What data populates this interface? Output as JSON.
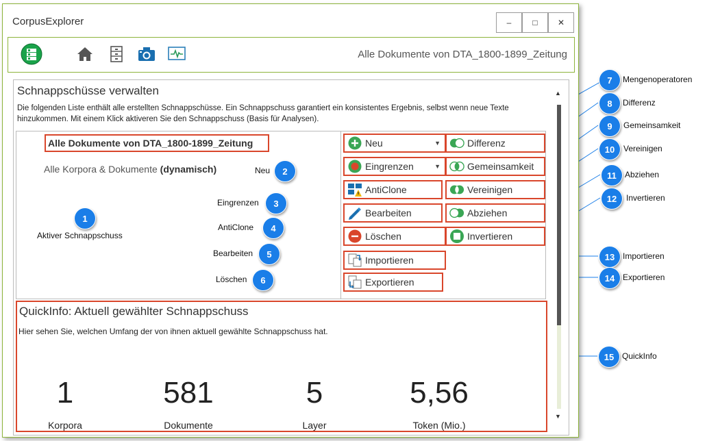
{
  "window": {
    "title": "CorpusExplorer",
    "minimize": "–",
    "maximize": "□",
    "close": "✕"
  },
  "toolbar": {
    "view_title": "Alle Dokumente von DTA_1800-1899_Zeitung"
  },
  "section": {
    "title": "Schnappschüsse verwalten",
    "description": "Die folgenden Liste enthält alle erstellten Schnappschüsse. Ein Schnappschuss garantiert ein konsistentes Ergebnis, selbst wenn neue Texte hinzukommen. Mit einem Klick aktiveren Sie den Schnappschuss (Basis für Analysen)."
  },
  "snapshots": {
    "active": "Alle Dokumente von DTA_1800-1899_Zeitung",
    "root": "Alle Korpora & Dokumente",
    "root_suffix": "(dynamisch)"
  },
  "actions": {
    "neu": "Neu",
    "eingrenzen": "Eingrenzen",
    "anticlone": "AntiClone",
    "bearbeiten": "Bearbeiten",
    "loeschen": "Löschen",
    "importieren": "Importieren",
    "exportieren": "Exportieren"
  },
  "set_operators": {
    "differenz": "Differenz",
    "gemeinsamkeit": "Gemeinsamkeit",
    "vereinigen": "Vereinigen",
    "abziehen": "Abziehen",
    "invertieren": "Invertieren"
  },
  "quickinfo": {
    "title": "QuickInfo: Aktuell gewählter Schnappschuss",
    "description": "Hier sehen Sie, welchen Umfang der von ihnen aktuell gewählte Schnappschuss hat.",
    "stats": [
      {
        "value": "1",
        "label": "Korpora"
      },
      {
        "value": "581",
        "label": "Dokumente"
      },
      {
        "value": "5",
        "label": "Layer"
      },
      {
        "value": "5,56",
        "label": "Token (Mio.)"
      }
    ]
  },
  "callouts": [
    {
      "num": "1",
      "label": "Aktiver Schnappschuss"
    },
    {
      "num": "2",
      "label": "Neu"
    },
    {
      "num": "3",
      "label": "Eingrenzen"
    },
    {
      "num": "4",
      "label": "AntiClone"
    },
    {
      "num": "5",
      "label": "Bearbeiten"
    },
    {
      "num": "6",
      "label": "Löschen"
    },
    {
      "num": "7",
      "label": "Mengenoperatoren"
    },
    {
      "num": "8",
      "label": "Differenz"
    },
    {
      "num": "9",
      "label": "Gemeinsamkeit"
    },
    {
      "num": "10",
      "label": "Vereinigen"
    },
    {
      "num": "11",
      "label": "Abziehen"
    },
    {
      "num": "12",
      "label": "Invertieren"
    },
    {
      "num": "13",
      "label": "Importieren"
    },
    {
      "num": "14",
      "label": "Exportieren"
    },
    {
      "num": "15",
      "label": "QuickInfo"
    }
  ],
  "colors": {
    "accent_green": "#8db43a",
    "callout_blue": "#1a7ee8",
    "highlight_red": "#d9462b"
  }
}
